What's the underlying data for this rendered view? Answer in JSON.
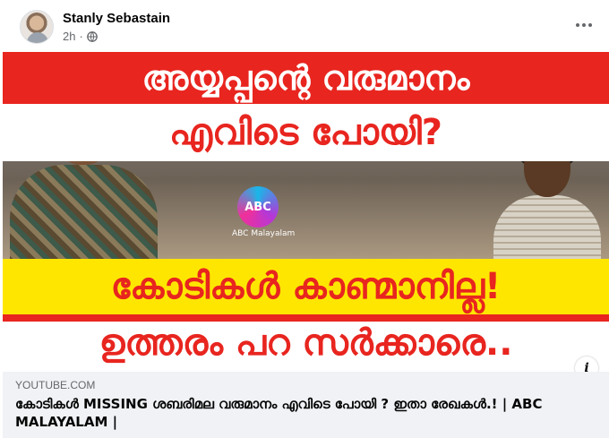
{
  "post": {
    "author": "Stanly Sebastain",
    "time": "2h",
    "separator": "·",
    "audience_icon": "globe-icon",
    "more_icon": "more-horizontal-icon"
  },
  "thumbnail": {
    "headline_line1": "അയ്യപ്പന്റെ വരുമാനം",
    "headline_line2": "എവിടെ പോയി?",
    "headline_line3": "കോടികൾ കാണ്മാനില്ല!",
    "headline_line4": "ഉത്തരം പറ സർക്കാരെ..",
    "logo_badge": "ABC",
    "logo_text": "ABC Malayalam",
    "colors": {
      "red": "#e8251f",
      "yellow": "#ffe600",
      "white": "#ffffff"
    }
  },
  "info_button": {
    "label": "i",
    "icon": "info-icon"
  },
  "link": {
    "domain": "YOUTUBE.COM",
    "title": "കോടികൾ MISSING ശബരിമല വരുമാനം എവിടെ പോയി ? ഇതാ രേഖകൾ.! | ABC MALAYALAM |"
  }
}
